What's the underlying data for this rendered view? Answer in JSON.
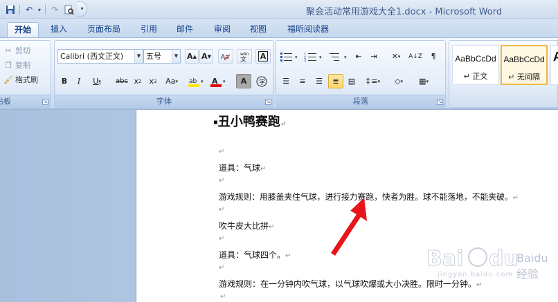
{
  "window": {
    "title": "聚会活动常用游戏大全1.docx - Microsoft Word"
  },
  "quick_access": {
    "customize_glyph": "▾"
  },
  "tabs": [
    {
      "label": "开始",
      "active": true
    },
    {
      "label": "插入"
    },
    {
      "label": "页面布局"
    },
    {
      "label": "引用"
    },
    {
      "label": "邮件"
    },
    {
      "label": "审阅"
    },
    {
      "label": "视图"
    },
    {
      "label": "福昕阅读器"
    }
  ],
  "clipboard": {
    "group_label": "剪贴板",
    "cut_label": "剪切",
    "copy_label": "复制",
    "format_painter_label": "格式刷"
  },
  "font": {
    "group_label": "字体",
    "font_name": "Calibri (西文正文)",
    "font_size": "五号"
  },
  "paragraph": {
    "group_label": "段落"
  },
  "styles": {
    "items": [
      {
        "sample": "AaBbCcDd",
        "name": "↵ 正文"
      },
      {
        "sample": "AaBbCcDd",
        "name": "↵ 无间隔",
        "selected": true
      },
      {
        "sample": "A",
        "name": ""
      }
    ]
  },
  "document": {
    "heading": "丑小鸭赛跑",
    "lines": [
      "道具：气球",
      "游戏规则：用膝盖夹住气球，进行接力赛跑，快者为胜。球不能落地，不能夹破。",
      "吹牛皮大比拼",
      "道具：气球四个。",
      "游戏规则：在一分钟内吹气球，以气球吹爆或大小决胜。限时一分钟。"
    ],
    "para_mark": "↵",
    "heading_bullet": "▪"
  },
  "watermark": {
    "text": "Baidu经验",
    "url_text": "jingyan.baidu.com"
  },
  "colors": {
    "accent": "#15428b",
    "highlight_yellow": "#ffe800",
    "font_color_red": "#e00000",
    "arrow_red": "#e8141c"
  }
}
